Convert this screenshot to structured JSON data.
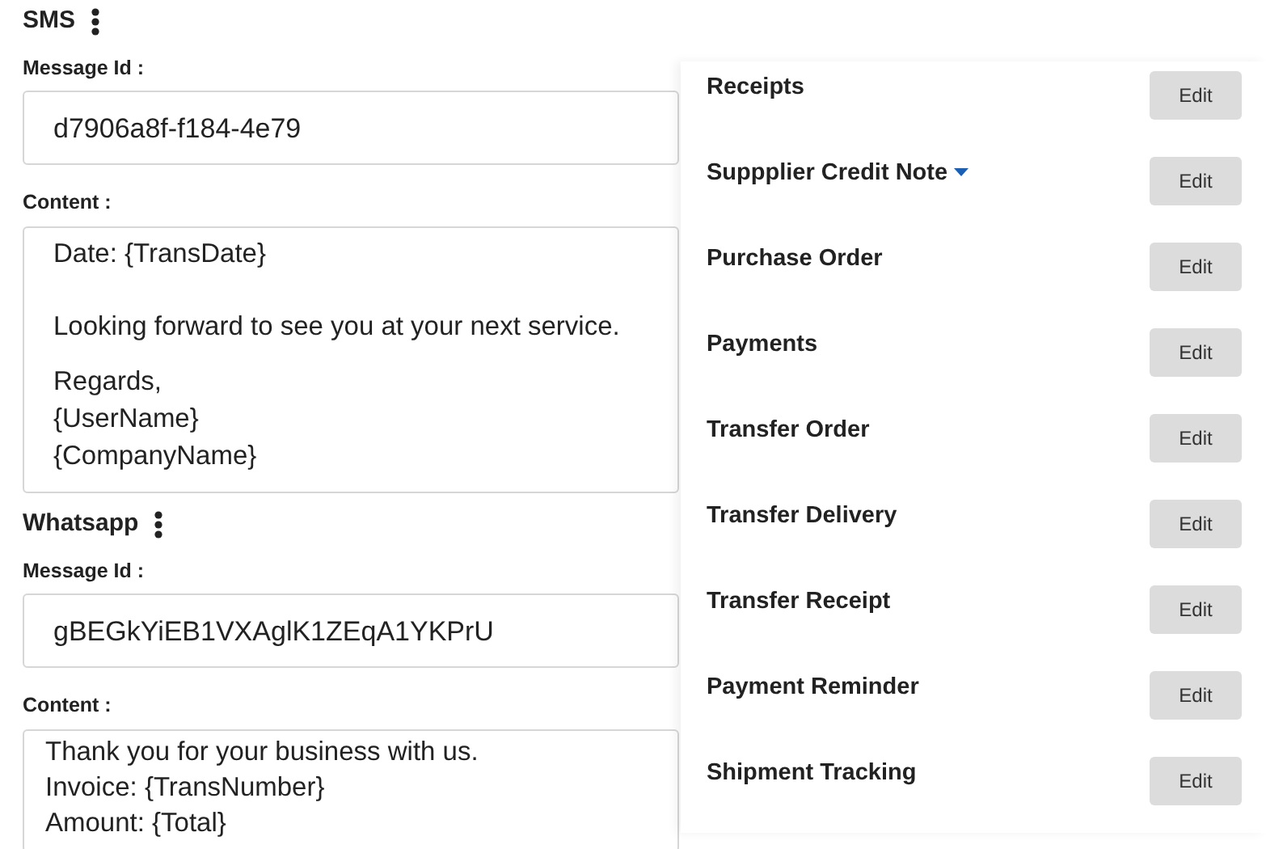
{
  "sections": [
    {
      "title": "SMS",
      "message_id_label": "Message Id :",
      "message_id": "d7906a8f-f184-4e79",
      "content_label": "Content :",
      "content": [
        [
          "Date: {TransDate}"
        ],
        [
          "Looking forward to see you at your next service."
        ],
        [
          "Regards,",
          "{UserName}",
          "{CompanyName}"
        ]
      ]
    },
    {
      "title": "Whatsapp",
      "message_id_label": "Message Id :",
      "message_id": "gBEGkYiEB1VXAglK1ZEqA1YKPrU",
      "content_label": "Content :",
      "content": [
        [
          "Thank you for your business with us.",
          "Invoice: {TransNumber}",
          "Amount: {Total}"
        ]
      ]
    }
  ],
  "panel": {
    "items": [
      {
        "label": "Receipts",
        "dropdown": false,
        "button": "Edit"
      },
      {
        "label": "Suppplier Credit Note",
        "dropdown": true,
        "button": "Edit"
      },
      {
        "label": "Purchase Order",
        "dropdown": false,
        "button": "Edit"
      },
      {
        "label": "Payments",
        "dropdown": false,
        "button": "Edit"
      },
      {
        "label": "Transfer Order",
        "dropdown": false,
        "button": "Edit"
      },
      {
        "label": "Transfer Delivery",
        "dropdown": false,
        "button": "Edit"
      },
      {
        "label": "Transfer Receipt",
        "dropdown": false,
        "button": "Edit"
      },
      {
        "label": "Payment Reminder",
        "dropdown": false,
        "button": "Edit"
      },
      {
        "label": "Shipment Tracking",
        "dropdown": false,
        "button": "Edit"
      }
    ]
  }
}
